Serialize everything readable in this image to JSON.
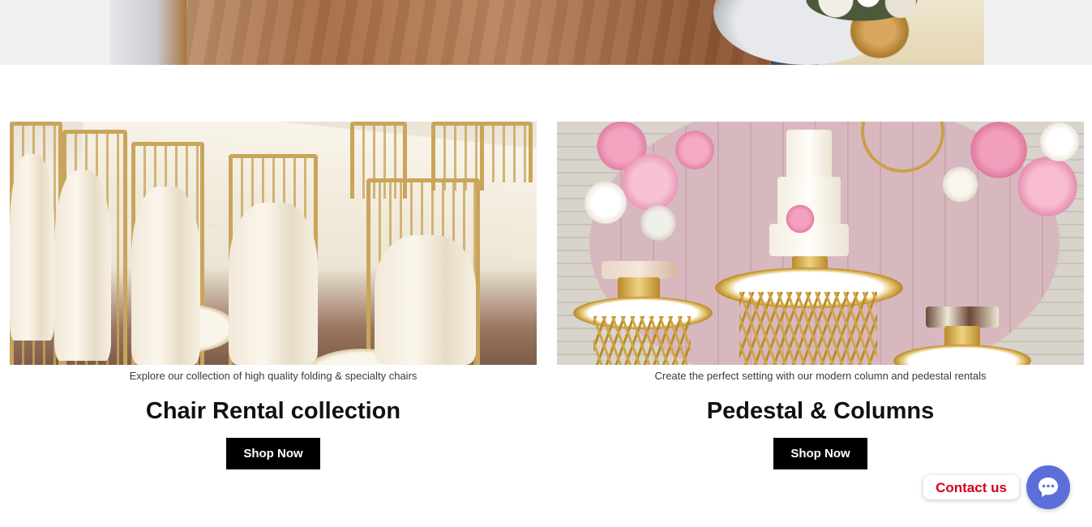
{
  "hero": {
    "image_name": "venue-hero-image"
  },
  "collections": [
    {
      "caption": "Explore our collection of high quality folding & specialty chairs",
      "title": "Chair Rental collection",
      "button_label": "Shop Now"
    },
    {
      "caption": "Create the perfect setting with our modern column and pedestal rentals",
      "title": "Pedestal & Columns",
      "button_label": "Shop Now"
    }
  ],
  "contact_widget": {
    "label": "Contact us",
    "icon": "chat-bubble-icon",
    "accent_color": "#5b6fd8",
    "label_color": "#d0021b"
  }
}
